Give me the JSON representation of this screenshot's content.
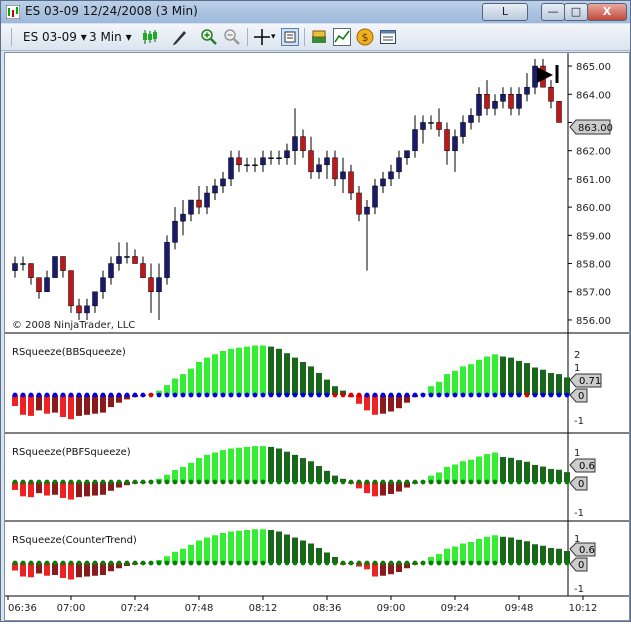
{
  "window": {
    "title": "ES 03-09  12/24/2008 (3 Min)",
    "controls": {
      "tab": "L",
      "minimize": "—",
      "maximize": "□",
      "close": "X"
    }
  },
  "toolbar": {
    "instrument": "ES 03-09",
    "interval": "3 Min",
    "icons": [
      "chart-style-icon",
      "drawing-pen-icon",
      "zoom-in-icon",
      "zoom-out-icon",
      "crosshair-icon",
      "data-box-icon",
      "instrument-icon",
      "indicators-icon",
      "strategy-icon",
      "properties-icon"
    ]
  },
  "price_panel": {
    "copyright": "© 2008 NinjaTrader, LLC",
    "current_price": "863.00",
    "y_ticks": [
      "865.00",
      "864.00",
      "863.00",
      "862.00",
      "861.00",
      "860.00",
      "859.00",
      "858.00",
      "857.00",
      "856.00"
    ]
  },
  "indicators": [
    {
      "label": "RSqueeze(BBSqueeze)",
      "ticks": [
        "2",
        "1",
        "0",
        "-1"
      ],
      "value_box": "0.71",
      "zero_box": "0"
    },
    {
      "label": "RSqueeze(PBFSqueeze)",
      "ticks": [
        "1",
        "0",
        "-1"
      ],
      "value_box": "0.6",
      "zero_box": "0"
    },
    {
      "label": "RSqueeze(CounterTrend)",
      "ticks": [
        "1",
        "0",
        "-1"
      ],
      "value_box": "0.6",
      "zero_box": "0"
    }
  ],
  "time_axis": [
    "06:36",
    "07:00",
    "07:24",
    "07:48",
    "08:12",
    "08:36",
    "09:00",
    "09:24",
    "09:48",
    "10:12"
  ],
  "colors": {
    "up_candle": "#1a1a6e",
    "down_candle": "#c0181a",
    "light_green": "#33ee33",
    "dark_green": "#1a661a",
    "red": "#ee2222",
    "dark_red": "#8b1a1a",
    "dot_blue": "#0000ee",
    "dot_red": "#dd0000",
    "dot_green": "#0a7a0a"
  },
  "chart_data": {
    "type": "candlestick",
    "price_axis": {
      "min": 855.75,
      "max": 865.25
    },
    "candles": [
      [
        857.75,
        858.25,
        857.5,
        858.0
      ],
      [
        858.0,
        858.25,
        857.75,
        858.0
      ],
      [
        858.0,
        858.0,
        857.25,
        857.5
      ],
      [
        857.5,
        857.5,
        856.75,
        857.0
      ],
      [
        857.0,
        857.75,
        857.0,
        857.5
      ],
      [
        857.5,
        858.25,
        857.5,
        858.25
      ],
      [
        858.25,
        858.25,
        857.5,
        857.75
      ],
      [
        857.75,
        857.75,
        856.25,
        856.5
      ],
      [
        856.5,
        856.75,
        856.0,
        856.25
      ],
      [
        856.25,
        856.75,
        856.0,
        856.5
      ],
      [
        856.5,
        857.0,
        856.25,
        857.0
      ],
      [
        857.0,
        857.75,
        856.75,
        857.5
      ],
      [
        857.5,
        858.25,
        857.25,
        858.0
      ],
      [
        858.0,
        858.75,
        857.75,
        858.25
      ],
      [
        858.25,
        858.75,
        858.0,
        858.25
      ],
      [
        858.25,
        858.5,
        858.0,
        858.0
      ],
      [
        858.0,
        858.25,
        857.5,
        857.5
      ],
      [
        857.5,
        858.0,
        856.25,
        857.0
      ],
      [
        857.0,
        858.0,
        856.0,
        857.5
      ],
      [
        857.5,
        859.0,
        857.25,
        858.75
      ],
      [
        858.75,
        860.0,
        858.5,
        859.5
      ],
      [
        859.5,
        860.25,
        859.0,
        859.75
      ],
      [
        859.75,
        860.25,
        859.5,
        860.25
      ],
      [
        860.25,
        860.75,
        859.75,
        860.0
      ],
      [
        860.0,
        860.75,
        859.75,
        860.5
      ],
      [
        860.5,
        861.0,
        860.25,
        860.75
      ],
      [
        860.75,
        861.25,
        860.5,
        861.0
      ],
      [
        861.0,
        862.0,
        860.75,
        861.75
      ],
      [
        861.75,
        862.0,
        861.25,
        861.5
      ],
      [
        861.5,
        861.75,
        861.25,
        861.5
      ],
      [
        861.5,
        861.75,
        861.25,
        861.5
      ],
      [
        861.5,
        862.0,
        861.25,
        861.75
      ],
      [
        861.75,
        862.0,
        861.5,
        861.75
      ],
      [
        861.75,
        862.0,
        861.5,
        861.75
      ],
      [
        861.75,
        862.25,
        861.5,
        862.0
      ],
      [
        862.0,
        863.5,
        861.5,
        862.5
      ],
      [
        862.5,
        862.75,
        861.75,
        862.0
      ],
      [
        862.0,
        862.5,
        861.0,
        861.25
      ],
      [
        861.25,
        861.75,
        861.0,
        861.5
      ],
      [
        861.5,
        862.0,
        861.0,
        861.75
      ],
      [
        861.75,
        862.0,
        860.75,
        861.0
      ],
      [
        861.0,
        861.75,
        860.5,
        861.25
      ],
      [
        861.25,
        861.5,
        860.25,
        860.5
      ],
      [
        860.5,
        860.75,
        859.5,
        859.75
      ],
      [
        859.75,
        860.25,
        857.75,
        860.0
      ],
      [
        860.0,
        861.0,
        859.75,
        860.75
      ],
      [
        860.75,
        861.25,
        860.5,
        861.0
      ],
      [
        861.0,
        861.5,
        860.75,
        861.25
      ],
      [
        861.25,
        862.0,
        861.0,
        861.75
      ],
      [
        861.75,
        862.0,
        861.5,
        862.0
      ],
      [
        862.0,
        863.25,
        861.75,
        862.75
      ],
      [
        862.75,
        863.25,
        862.25,
        863.0
      ],
      [
        863.0,
        863.25,
        862.75,
        863.0
      ],
      [
        863.0,
        863.5,
        862.5,
        862.75
      ],
      [
        862.75,
        863.0,
        861.5,
        862.0
      ],
      [
        862.0,
        862.75,
        861.25,
        862.5
      ],
      [
        862.5,
        863.25,
        862.25,
        863.0
      ],
      [
        863.0,
        863.5,
        862.75,
        863.25
      ],
      [
        863.25,
        864.25,
        863.0,
        864.0
      ],
      [
        864.0,
        864.5,
        863.25,
        863.5
      ],
      [
        863.5,
        864.0,
        863.25,
        863.75
      ],
      [
        863.75,
        864.25,
        863.5,
        864.0
      ],
      [
        864.0,
        864.25,
        863.25,
        863.5
      ],
      [
        863.5,
        864.25,
        863.25,
        864.0
      ],
      [
        864.0,
        864.75,
        863.75,
        864.25
      ],
      [
        864.25,
        865.25,
        864.0,
        865.0
      ],
      [
        865.0,
        865.25,
        864.25,
        864.25
      ],
      [
        864.25,
        864.5,
        863.5,
        863.75
      ],
      [
        863.75,
        863.75,
        863.0,
        863.0
      ]
    ],
    "squeeze_bbs": {
      "ylim": [
        -1.2,
        2.4
      ],
      "values": [
        -0.5,
        -0.9,
        -0.95,
        -0.7,
        -0.85,
        -0.8,
        -1.0,
        -1.1,
        -0.95,
        -0.9,
        -0.85,
        -0.8,
        -0.55,
        -0.35,
        -0.2,
        -0.1,
        -0.05,
        0.05,
        0.2,
        0.45,
        0.75,
        0.95,
        1.2,
        1.5,
        1.7,
        1.85,
        2.0,
        2.1,
        2.15,
        2.2,
        2.25,
        2.25,
        2.2,
        2.1,
        1.9,
        1.7,
        1.5,
        1.3,
        1.0,
        0.7,
        0.4,
        0.2,
        -0.1,
        -0.4,
        -0.7,
        -0.9,
        -0.85,
        -0.75,
        -0.6,
        -0.35,
        -0.1,
        0.05,
        0.4,
        0.6,
        0.95,
        1.1,
        1.3,
        1.4,
        1.6,
        1.75,
        1.85,
        1.75,
        1.7,
        1.55,
        1.45,
        1.25,
        1.15,
        1.0,
        0.95,
        0.8
      ]
    }
  }
}
